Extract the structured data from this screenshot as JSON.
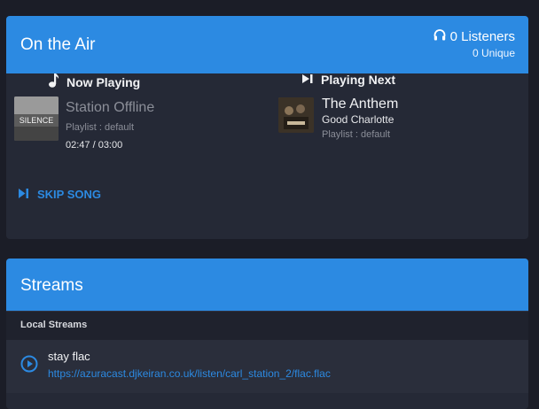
{
  "on_air": {
    "title": "On the Air",
    "listeners": "0 Listeners",
    "unique": "0 Unique"
  },
  "now_playing": {
    "heading": "Now Playing",
    "title": "Station Offline",
    "playlist": "Playlist : default",
    "time": "02:47 / 03:00",
    "art_text": "SILENCE"
  },
  "playing_next": {
    "heading": "Playing Next",
    "title": "The Anthem",
    "artist": "Good Charlotte",
    "playlist": "Playlist : default"
  },
  "skip_label": "SKIP SONG",
  "streams": {
    "title": "Streams",
    "section_label": "Local Streams",
    "items": [
      {
        "name": "stay flac",
        "url": "https://azuracast.djkeiran.co.uk/listen/carl_station_2/flac.flac"
      }
    ]
  },
  "colors": {
    "accent": "#2c8ae2",
    "background": "#1b1d27",
    "card": "#252936"
  },
  "icons": [
    "headphones-icon",
    "music-note-icon",
    "skip-next-icon",
    "play-circle-icon"
  ]
}
